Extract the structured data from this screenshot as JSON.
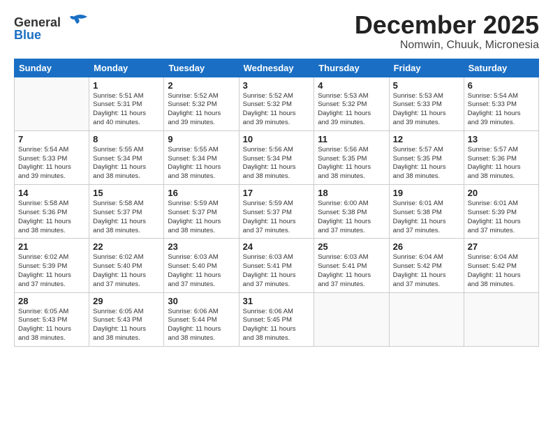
{
  "header": {
    "logo_line1": "General",
    "logo_line2": "Blue",
    "month": "December 2025",
    "location": "Nomwin, Chuuk, Micronesia"
  },
  "days_of_week": [
    "Sunday",
    "Monday",
    "Tuesday",
    "Wednesday",
    "Thursday",
    "Friday",
    "Saturday"
  ],
  "weeks": [
    [
      {
        "day": "",
        "info": ""
      },
      {
        "day": "1",
        "info": "Sunrise: 5:51 AM\nSunset: 5:31 PM\nDaylight: 11 hours\nand 40 minutes."
      },
      {
        "day": "2",
        "info": "Sunrise: 5:52 AM\nSunset: 5:32 PM\nDaylight: 11 hours\nand 39 minutes."
      },
      {
        "day": "3",
        "info": "Sunrise: 5:52 AM\nSunset: 5:32 PM\nDaylight: 11 hours\nand 39 minutes."
      },
      {
        "day": "4",
        "info": "Sunrise: 5:53 AM\nSunset: 5:32 PM\nDaylight: 11 hours\nand 39 minutes."
      },
      {
        "day": "5",
        "info": "Sunrise: 5:53 AM\nSunset: 5:33 PM\nDaylight: 11 hours\nand 39 minutes."
      },
      {
        "day": "6",
        "info": "Sunrise: 5:54 AM\nSunset: 5:33 PM\nDaylight: 11 hours\nand 39 minutes."
      }
    ],
    [
      {
        "day": "7",
        "info": "Sunrise: 5:54 AM\nSunset: 5:33 PM\nDaylight: 11 hours\nand 39 minutes."
      },
      {
        "day": "8",
        "info": "Sunrise: 5:55 AM\nSunset: 5:34 PM\nDaylight: 11 hours\nand 38 minutes."
      },
      {
        "day": "9",
        "info": "Sunrise: 5:55 AM\nSunset: 5:34 PM\nDaylight: 11 hours\nand 38 minutes."
      },
      {
        "day": "10",
        "info": "Sunrise: 5:56 AM\nSunset: 5:34 PM\nDaylight: 11 hours\nand 38 minutes."
      },
      {
        "day": "11",
        "info": "Sunrise: 5:56 AM\nSunset: 5:35 PM\nDaylight: 11 hours\nand 38 minutes."
      },
      {
        "day": "12",
        "info": "Sunrise: 5:57 AM\nSunset: 5:35 PM\nDaylight: 11 hours\nand 38 minutes."
      },
      {
        "day": "13",
        "info": "Sunrise: 5:57 AM\nSunset: 5:36 PM\nDaylight: 11 hours\nand 38 minutes."
      }
    ],
    [
      {
        "day": "14",
        "info": "Sunrise: 5:58 AM\nSunset: 5:36 PM\nDaylight: 11 hours\nand 38 minutes."
      },
      {
        "day": "15",
        "info": "Sunrise: 5:58 AM\nSunset: 5:37 PM\nDaylight: 11 hours\nand 38 minutes."
      },
      {
        "day": "16",
        "info": "Sunrise: 5:59 AM\nSunset: 5:37 PM\nDaylight: 11 hours\nand 38 minutes."
      },
      {
        "day": "17",
        "info": "Sunrise: 5:59 AM\nSunset: 5:37 PM\nDaylight: 11 hours\nand 37 minutes."
      },
      {
        "day": "18",
        "info": "Sunrise: 6:00 AM\nSunset: 5:38 PM\nDaylight: 11 hours\nand 37 minutes."
      },
      {
        "day": "19",
        "info": "Sunrise: 6:01 AM\nSunset: 5:38 PM\nDaylight: 11 hours\nand 37 minutes."
      },
      {
        "day": "20",
        "info": "Sunrise: 6:01 AM\nSunset: 5:39 PM\nDaylight: 11 hours\nand 37 minutes."
      }
    ],
    [
      {
        "day": "21",
        "info": "Sunrise: 6:02 AM\nSunset: 5:39 PM\nDaylight: 11 hours\nand 37 minutes."
      },
      {
        "day": "22",
        "info": "Sunrise: 6:02 AM\nSunset: 5:40 PM\nDaylight: 11 hours\nand 37 minutes."
      },
      {
        "day": "23",
        "info": "Sunrise: 6:03 AM\nSunset: 5:40 PM\nDaylight: 11 hours\nand 37 minutes."
      },
      {
        "day": "24",
        "info": "Sunrise: 6:03 AM\nSunset: 5:41 PM\nDaylight: 11 hours\nand 37 minutes."
      },
      {
        "day": "25",
        "info": "Sunrise: 6:03 AM\nSunset: 5:41 PM\nDaylight: 11 hours\nand 37 minutes."
      },
      {
        "day": "26",
        "info": "Sunrise: 6:04 AM\nSunset: 5:42 PM\nDaylight: 11 hours\nand 37 minutes."
      },
      {
        "day": "27",
        "info": "Sunrise: 6:04 AM\nSunset: 5:42 PM\nDaylight: 11 hours\nand 38 minutes."
      }
    ],
    [
      {
        "day": "28",
        "info": "Sunrise: 6:05 AM\nSunset: 5:43 PM\nDaylight: 11 hours\nand 38 minutes."
      },
      {
        "day": "29",
        "info": "Sunrise: 6:05 AM\nSunset: 5:43 PM\nDaylight: 11 hours\nand 38 minutes."
      },
      {
        "day": "30",
        "info": "Sunrise: 6:06 AM\nSunset: 5:44 PM\nDaylight: 11 hours\nand 38 minutes."
      },
      {
        "day": "31",
        "info": "Sunrise: 6:06 AM\nSunset: 5:45 PM\nDaylight: 11 hours\nand 38 minutes."
      },
      {
        "day": "",
        "info": ""
      },
      {
        "day": "",
        "info": ""
      },
      {
        "day": "",
        "info": ""
      }
    ]
  ]
}
